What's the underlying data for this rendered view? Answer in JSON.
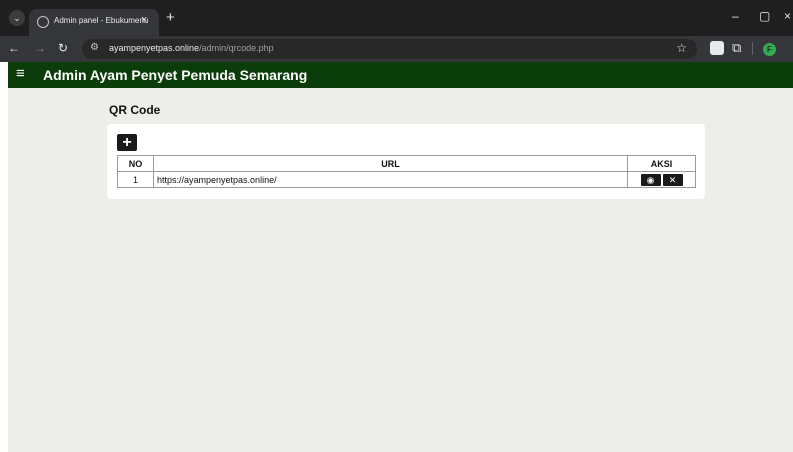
{
  "browser": {
    "tab_title": "Admin panel - Ebukumenu",
    "url_host": "ayampenyetpas.online",
    "url_path": "/admin/qrcode.php",
    "profile_initial": "F"
  },
  "app": {
    "title": "Admin Ayam Penyet Pemuda Semarang"
  },
  "main": {
    "section_title": "QR Code",
    "add_label": "+",
    "table": {
      "columns": [
        "NO",
        "URL",
        "AKSI"
      ],
      "rows": [
        {
          "no": "1",
          "url": "https://ayampenyetpas.online/"
        }
      ]
    }
  },
  "colors": {
    "header_bg": "#0b3d0b",
    "page_bg": "#ededea",
    "button_bg": "#1a1a1a"
  }
}
